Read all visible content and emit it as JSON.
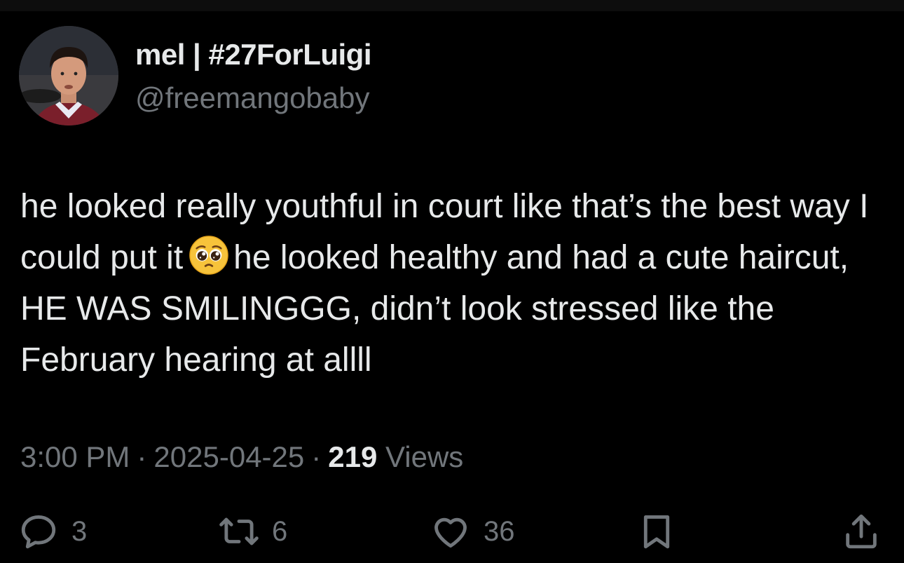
{
  "author": {
    "display_name": "mel | #27ForLuigi",
    "handle": "@freemangobaby"
  },
  "tweet": {
    "text_part1": "he looked really youthful in court like that’s the best way I could put it",
    "emoji": "pleading-face",
    "text_part2": "he looked healthy and had a cute haircut, HE WAS SMILINGGG, didn’t look stressed like the February hearing at allll"
  },
  "meta": {
    "time": "3:00 PM",
    "separator": "·",
    "date": "2025-04-25",
    "views_count": "219",
    "views_label": "Views"
  },
  "actions": {
    "replies": "3",
    "retweets": "6",
    "likes": "36"
  },
  "colors": {
    "background": "#000000",
    "text_primary": "#e7e9ea",
    "text_secondary": "#71767b"
  },
  "icons": [
    "reply-icon",
    "retweet-icon",
    "like-icon",
    "bookmark-icon",
    "share-icon"
  ]
}
